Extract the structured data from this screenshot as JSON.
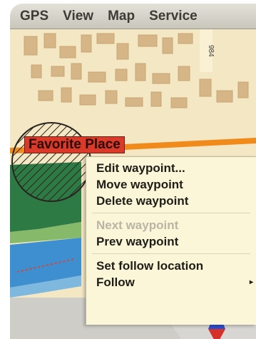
{
  "menubar": {
    "items": [
      "GPS",
      "View",
      "Map",
      "Service"
    ]
  },
  "map": {
    "favorite_label": "Favorite Place",
    "street_text": "984"
  },
  "context_menu": {
    "group1": [
      "Edit waypoint...",
      "Move waypoint",
      "Delete waypoint"
    ],
    "group2": [
      {
        "label": "Next waypoint",
        "enabled": false
      },
      {
        "label": "Prev waypoint",
        "enabled": true
      }
    ],
    "group3": [
      {
        "label": "Set follow location",
        "has_submenu": false
      },
      {
        "label": "Follow",
        "has_submenu": true
      }
    ],
    "submenu_arrow": "▸"
  },
  "colors": {
    "map_background": "#f4e7c4",
    "water": "#3e8fd0",
    "park": "#2e7a44",
    "road_orange": "#f08a1a",
    "favorite_label_bg": "#d93a2a",
    "menu_bg": "#fbf6d8"
  },
  "icons": {
    "compass": "compass-arrow-icon"
  }
}
